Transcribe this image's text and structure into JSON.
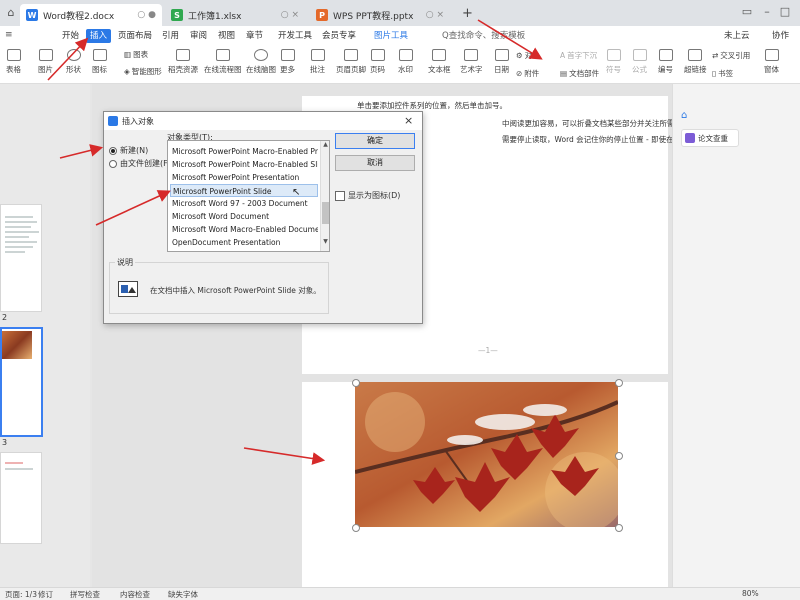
{
  "tabs": [
    {
      "label": "Word教程2.docx",
      "icon": "W",
      "color": "#2b79e6"
    },
    {
      "label": "工作簿1.xlsx",
      "icon": "S",
      "color": "#2fa84f"
    },
    {
      "label": "WPS PPT教程.pptx",
      "icon": "P",
      "color": "#e4692a"
    }
  ],
  "tab_add": "+",
  "menu": [
    "开始",
    "插入",
    "页面布局",
    "引用",
    "审阅",
    "视图",
    "章节",
    "开发工具",
    "会员专享",
    "图片工具"
  ],
  "menu_selected": "插入",
  "search_label": "Q查找命令、搜索模板",
  "user_label": "未上云",
  "collab_label": "协作",
  "toolbar": {
    "left": [
      "表格",
      "图片",
      "形状",
      "图标",
      "图表",
      "智能图形",
      "稻壳资源",
      "在线流程图",
      "在线脑图",
      "更多",
      "批注",
      "页眉页脚",
      "页码",
      "水印",
      "文本框",
      "艺术字",
      "日期",
      "附件",
      "对象",
      "文档部件",
      "首字下沉",
      "符号",
      "公式",
      "编号",
      "超链接",
      "书签",
      "交叉引用",
      "窗体"
    ]
  },
  "dialog": {
    "title": "插入对象",
    "close": "×",
    "option_new": "新建(N)",
    "option_file": "由文件创建(F)",
    "list_label": "对象类型(T):",
    "items": [
      "Microsoft PowerPoint Macro-Enabled Pre...",
      "Microsoft PowerPoint Macro-Enabled Slide",
      "Microsoft PowerPoint Presentation",
      "Microsoft PowerPoint Slide",
      "Microsoft Word 97 - 2003 Document",
      "Microsoft Word Document",
      "Microsoft Word Macro-Enabled Document",
      "OpenDocument Presentation"
    ],
    "selected_index": 3,
    "ok": "确定",
    "cancel": "取消",
    "display_as_icon": "显示为图标(D)",
    "desc_label": "说明",
    "desc_text": "在文档中插入 Microsoft PowerPoint Slide 对象。"
  },
  "document": {
    "line1": "单击要添加控件系列的位置，然后单击加号。",
    "line2": "中阅读更加容易，可以折叠文档某些部分并关注所需文本。",
    "line3": "需要停止读取，Word 会记住你的停止位置 - 即使在另",
    "page_marker": "—1—"
  },
  "right_panel": {
    "button": "论文查重"
  },
  "nav": {
    "thumb_nums": [
      "2",
      "3"
    ]
  },
  "status": {
    "page": "页面: 1/3",
    "words": "字数: 47",
    "track": "修订",
    "spell": "拼写检查",
    "content_check": "内容检查",
    "missing_font": "缺失字体",
    "zoom": "80%"
  },
  "colors": {
    "accent": "#2b79e6",
    "arrow": "#d62a2a"
  }
}
